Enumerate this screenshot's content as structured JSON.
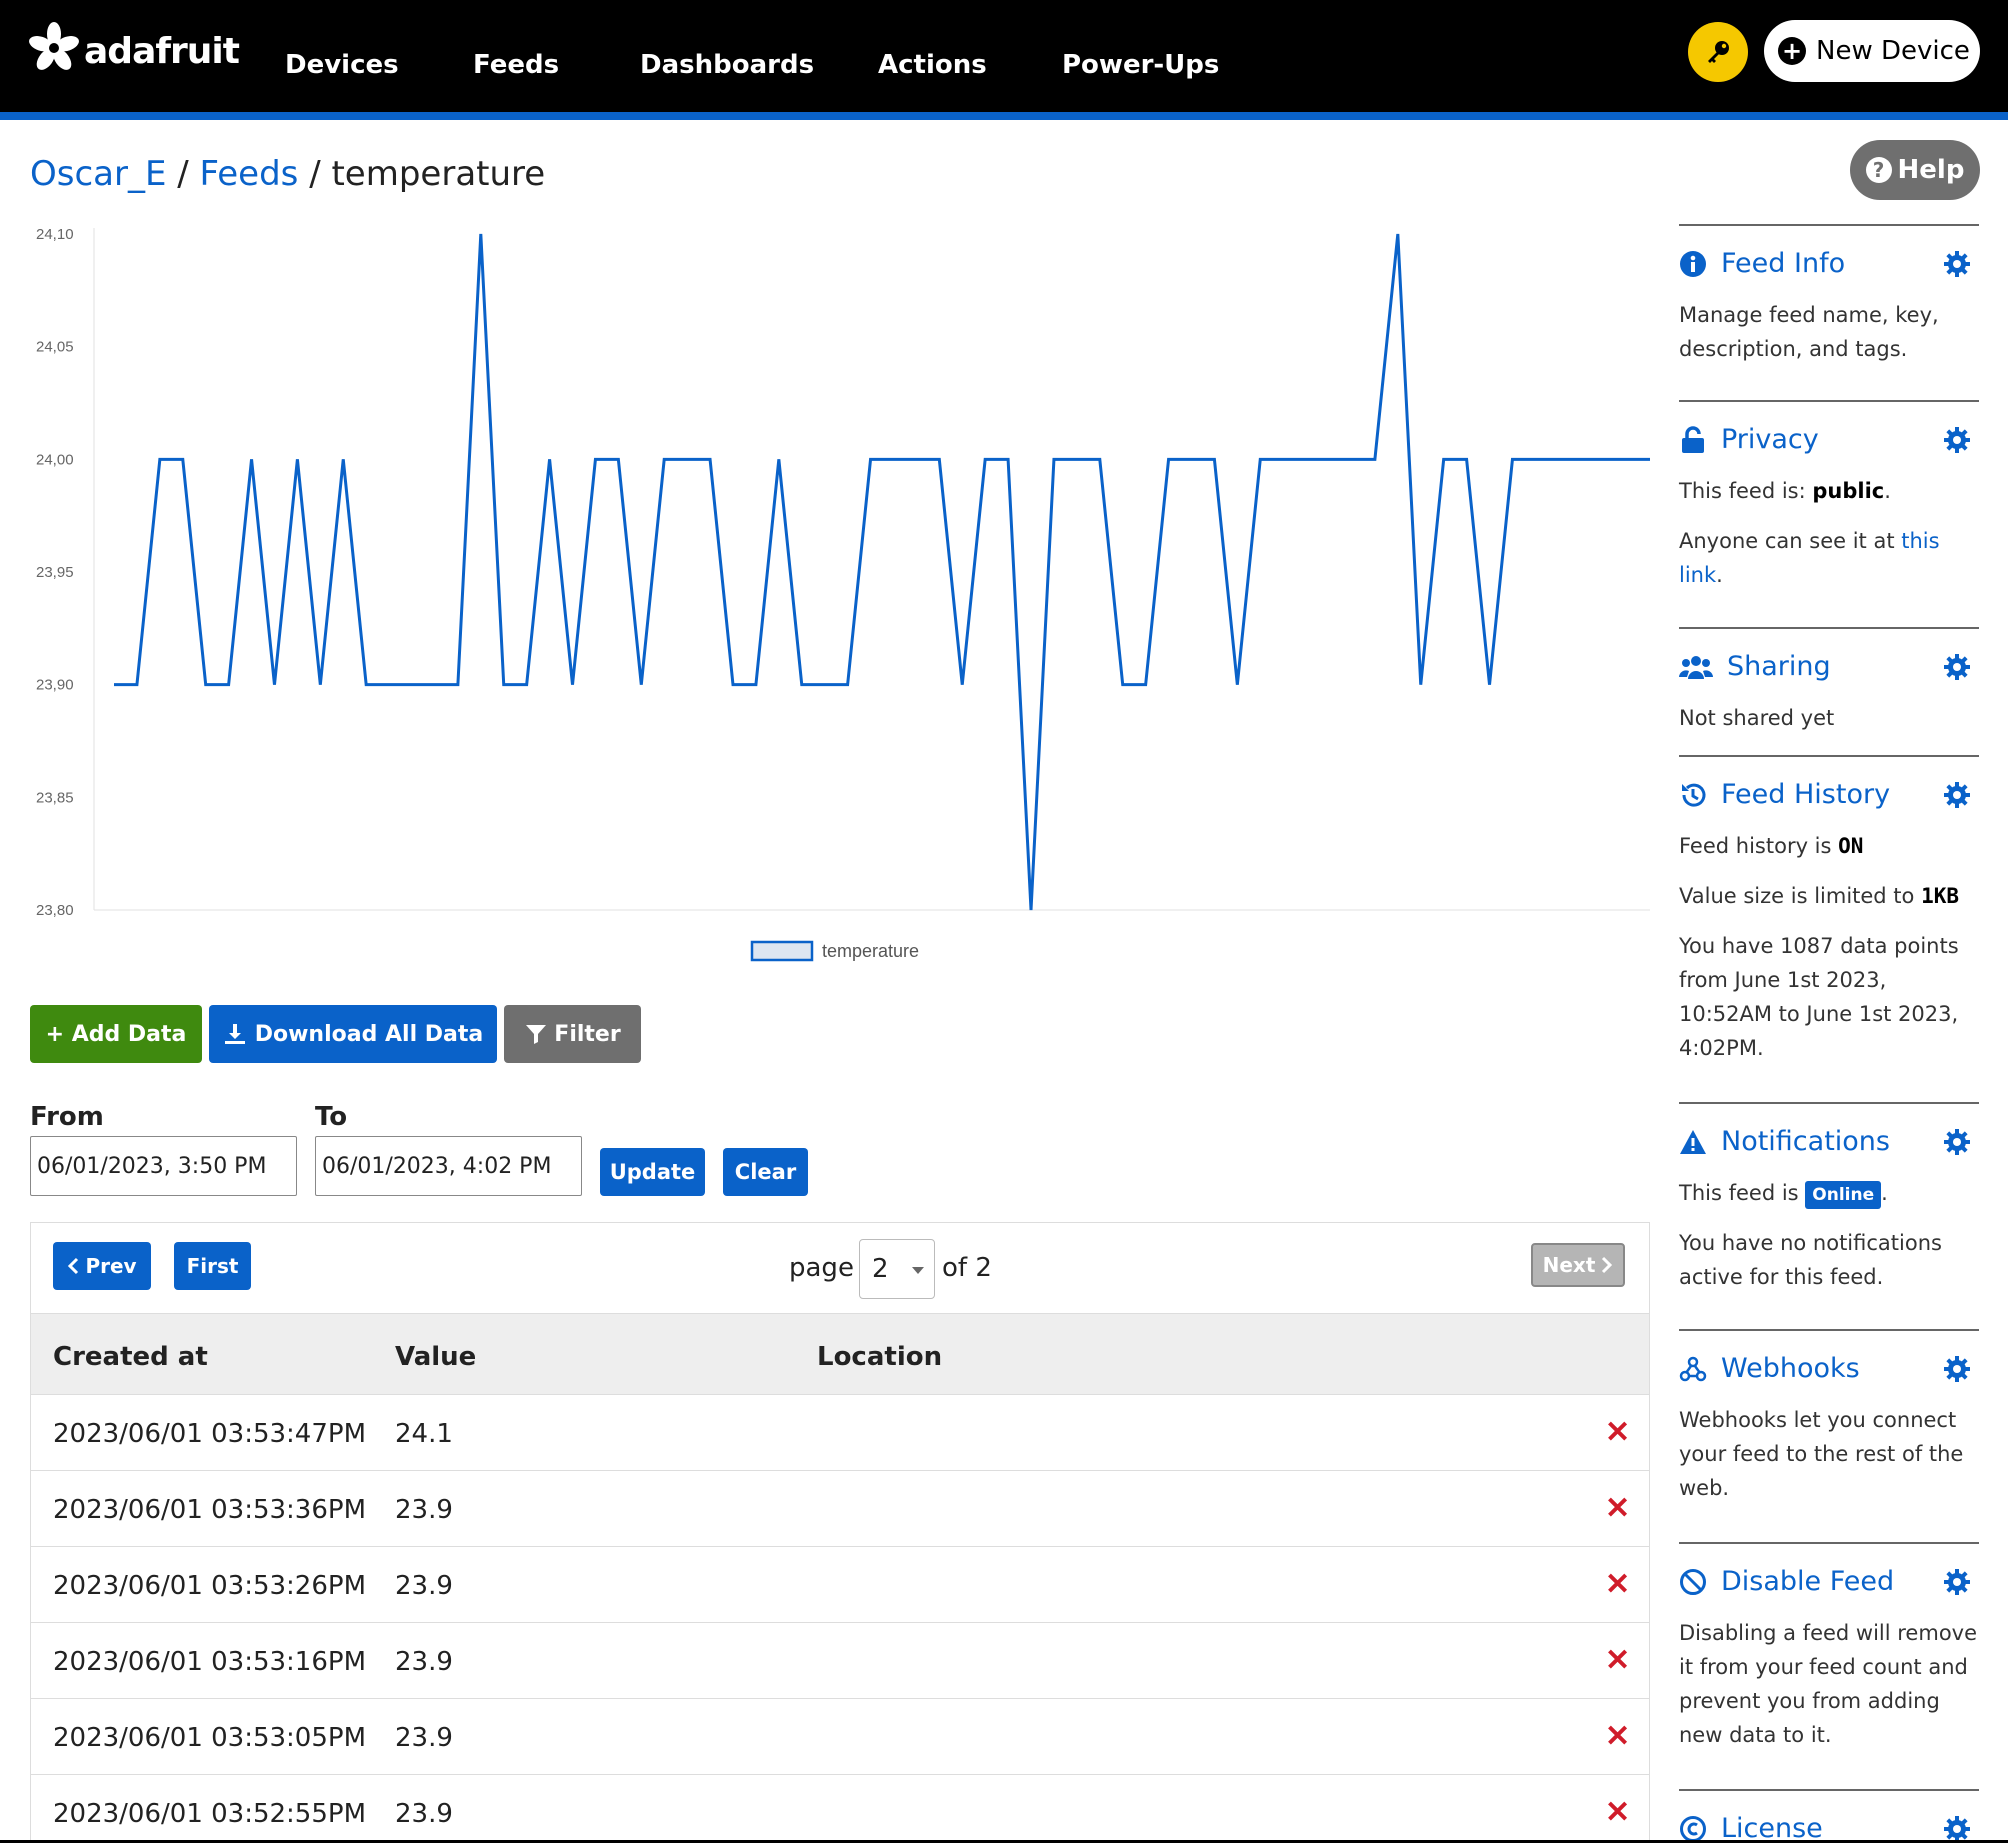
{
  "nav": {
    "brand": "adafruit",
    "links": [
      "Devices",
      "Feeds",
      "Dashboards",
      "Actions",
      "Power-Ups"
    ],
    "new_device": "New Device"
  },
  "breadcrumb": {
    "user": "Oscar_E",
    "section": "Feeds",
    "feed": "temperature",
    "sep": " / "
  },
  "help": "Help",
  "chart_data": {
    "type": "line",
    "series": [
      {
        "name": "temperature",
        "color": "#0a62c9",
        "values": [
          23.9,
          23.9,
          24.0,
          24.0,
          23.9,
          23.9,
          24.0,
          23.9,
          24.0,
          23.9,
          24.0,
          23.9,
          23.9,
          23.9,
          23.9,
          23.9,
          24.1,
          23.9,
          23.9,
          24.0,
          23.9,
          24.0,
          24.0,
          23.9,
          24.0,
          24.0,
          24.0,
          23.9,
          23.9,
          24.0,
          23.9,
          23.9,
          23.9,
          24.0,
          24.0,
          24.0,
          24.0,
          23.9,
          24.0,
          24.0,
          23.8,
          24.0,
          24.0,
          24.0,
          23.9,
          23.9,
          24.0,
          24.0,
          24.0,
          23.9,
          24.0,
          24.0,
          24.0,
          24.0,
          24.0,
          24.0,
          24.1,
          23.9,
          24.0,
          24.0,
          23.9,
          24.0,
          24.0,
          24.0,
          24.0,
          24.0,
          24.0,
          24.0
        ]
      }
    ],
    "ylim": [
      23.8,
      24.1
    ],
    "yticks": [
      "24,10",
      "24,05",
      "24,00",
      "23,95",
      "23,90",
      "23,85",
      "23,80"
    ],
    "legend": "bottom-center",
    "grid": false
  },
  "actions": {
    "add_data": "+ Add Data",
    "download": "Download All Data",
    "filter": "Filter"
  },
  "range": {
    "from_label": "From",
    "to_label": "To",
    "from_value": "06/01/2023, 3:50 PM",
    "to_value": "06/01/2023, 4:02 PM",
    "update": "Update",
    "clear": "Clear"
  },
  "pager": {
    "prev": "Prev",
    "first": "First",
    "page_label": "page",
    "current": "2",
    "of_label": "of 2",
    "next": "Next"
  },
  "table": {
    "headers": [
      "Created at",
      "Value",
      "Location"
    ],
    "rows": [
      {
        "created": "2023/06/01 03:53:47PM",
        "value": "24.1"
      },
      {
        "created": "2023/06/01 03:53:36PM",
        "value": "23.9"
      },
      {
        "created": "2023/06/01 03:53:26PM",
        "value": "23.9"
      },
      {
        "created": "2023/06/01 03:53:16PM",
        "value": "23.9"
      },
      {
        "created": "2023/06/01 03:53:05PM",
        "value": "23.9"
      },
      {
        "created": "2023/06/01 03:52:55PM",
        "value": "23.9"
      }
    ],
    "delete_glyph": "✕"
  },
  "sidebar": {
    "feed_info": {
      "title": "Feed Info",
      "text": "Manage feed name, key, description, and tags."
    },
    "privacy": {
      "title": "Privacy",
      "text1": "This feed is: ",
      "status": "public",
      "text1_end": ".",
      "text2": "Anyone can see it at ",
      "link": "this link",
      "text2_end": "."
    },
    "sharing": {
      "title": "Sharing",
      "text": "Not shared yet"
    },
    "history": {
      "title": "Feed History",
      "line1": "Feed history is ",
      "line1_val": "ON",
      "line2": "Value size is limited to ",
      "line2_val": "1KB",
      "line3": "You have 1087 data points from June 1st 2023, 10:52AM to June 1st 2023, 4:02PM."
    },
    "notifications": {
      "title": "Notifications",
      "line1": "This feed is ",
      "badge": "Online",
      "line1_end": ".",
      "line2": "You have no notifications active for this feed."
    },
    "webhooks": {
      "title": "Webhooks",
      "text": "Webhooks let you connect your feed to the rest of the web."
    },
    "disable": {
      "title": "Disable Feed",
      "text": "Disabling a feed will remove it from your feed count and prevent you from adding new data to it."
    },
    "license": {
      "title": "License"
    }
  }
}
